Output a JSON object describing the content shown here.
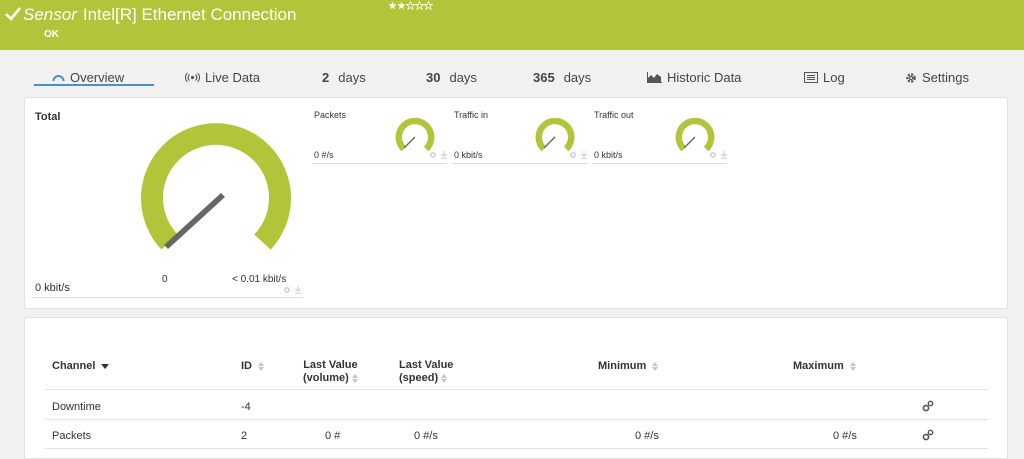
{
  "header": {
    "sensor_word": "Sensor",
    "sensor_name": "Intel[R] Ethernet Connection",
    "status": "OK",
    "rating": 2,
    "color": "#b4c43a"
  },
  "tabs": [
    {
      "num": "",
      "label": "Overview",
      "icon": "gauge-icon"
    },
    {
      "num": "",
      "label": "Live Data",
      "icon": "live-signal-icon"
    },
    {
      "num": "2",
      "label": "days",
      "icon": ""
    },
    {
      "num": "30",
      "label": "days",
      "icon": ""
    },
    {
      "num": "365",
      "label": "days",
      "icon": ""
    },
    {
      "num": "",
      "label": "Historic Data",
      "icon": "area-chart-icon"
    },
    {
      "num": "",
      "label": "Log",
      "icon": "log-icon"
    },
    {
      "num": "",
      "label": "Settings",
      "icon": "gear-icon"
    }
  ],
  "gauges": {
    "total": {
      "label": "Total",
      "value": "0 kbit/s",
      "min": "0",
      "max": "< 0.01 kbit/s"
    },
    "small": [
      {
        "label": "Packets",
        "value": "0 #/s"
      },
      {
        "label": "Traffic in",
        "value": "0 kbit/s"
      },
      {
        "label": "Traffic out",
        "value": "0 kbit/s"
      }
    ]
  },
  "table": {
    "headers": {
      "channel": "Channel",
      "id": "ID",
      "last_volume_1": "Last Value",
      "last_volume_2": "(volume)",
      "last_speed_1": "Last Value",
      "last_speed_2": "(speed)",
      "minimum": "Minimum",
      "maximum": "Maximum"
    },
    "rows": [
      {
        "channel": "Downtime",
        "id": "-4",
        "volume": "",
        "speed": "",
        "min": "",
        "max": ""
      },
      {
        "channel": "Packets",
        "id": "2",
        "volume": "0 #",
        "speed": "0 #/s",
        "min": "0 #/s",
        "max": "0 #/s"
      }
    ]
  }
}
